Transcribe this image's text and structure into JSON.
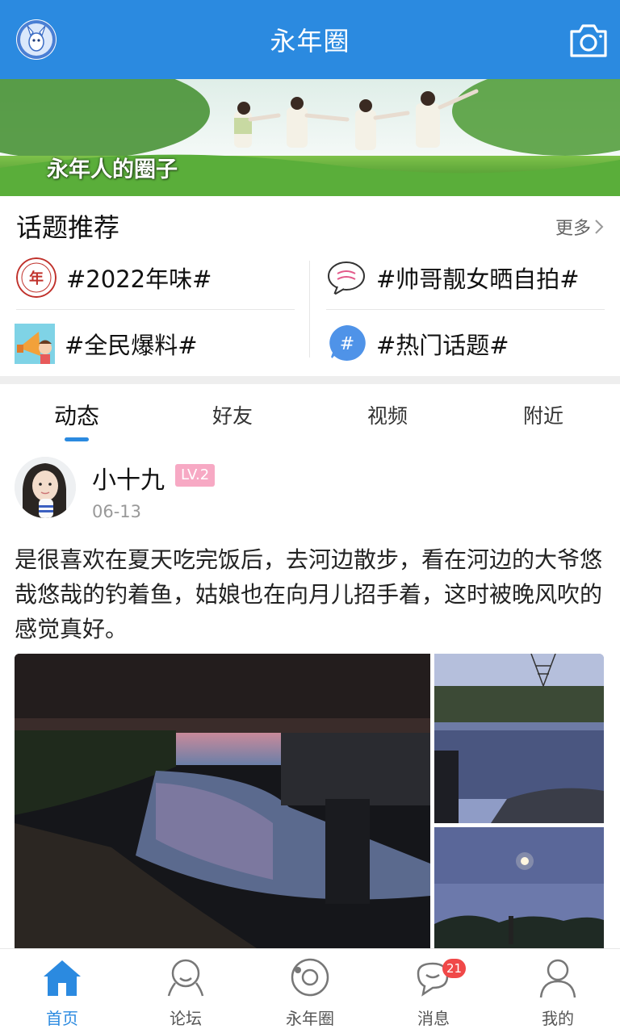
{
  "header": {
    "title": "永年圈",
    "left_icon": "app-logo",
    "right_icon": "camera-icon",
    "color": "#2b8ae0"
  },
  "banner": {
    "caption": "永年人的圈子"
  },
  "topics": {
    "heading": "话题推荐",
    "more_label": "更多",
    "items": [
      {
        "label": "#2022年味#",
        "icon": "nianwei-badge-icon"
      },
      {
        "label": "#帅哥靓女晒自拍#",
        "icon": "speech-bubble-icon"
      },
      {
        "label": "#全民爆料#",
        "icon": "megaphone-icon"
      },
      {
        "label": "#热门话题#",
        "icon": "hashtag-icon"
      }
    ]
  },
  "tabs": [
    {
      "label": "动态",
      "active": true
    },
    {
      "label": "好友",
      "active": false
    },
    {
      "label": "视频",
      "active": false
    },
    {
      "label": "附近",
      "active": false
    }
  ],
  "post": {
    "username": "小十九",
    "level": "LV.2",
    "date": "06-13",
    "text": "是很喜欢在夏天吃完饭后，去河边散步，看在河边的大爷悠哉悠哉的钓着鱼，姑娘也在向月儿招手着，这时被晚风吹的感觉真好。"
  },
  "bottom_nav": [
    {
      "label": "首页",
      "icon": "home-icon",
      "active": true
    },
    {
      "label": "论坛",
      "icon": "forum-icon",
      "active": false
    },
    {
      "label": "永年圈",
      "icon": "circle-icon",
      "active": false
    },
    {
      "label": "消息",
      "icon": "message-icon",
      "active": false,
      "badge": "21"
    },
    {
      "label": "我的",
      "icon": "profile-icon",
      "active": false
    }
  ],
  "colors": {
    "accent": "#2b8ae0",
    "level_badge": "#f7a9c4",
    "notification_badge": "#f04848"
  }
}
